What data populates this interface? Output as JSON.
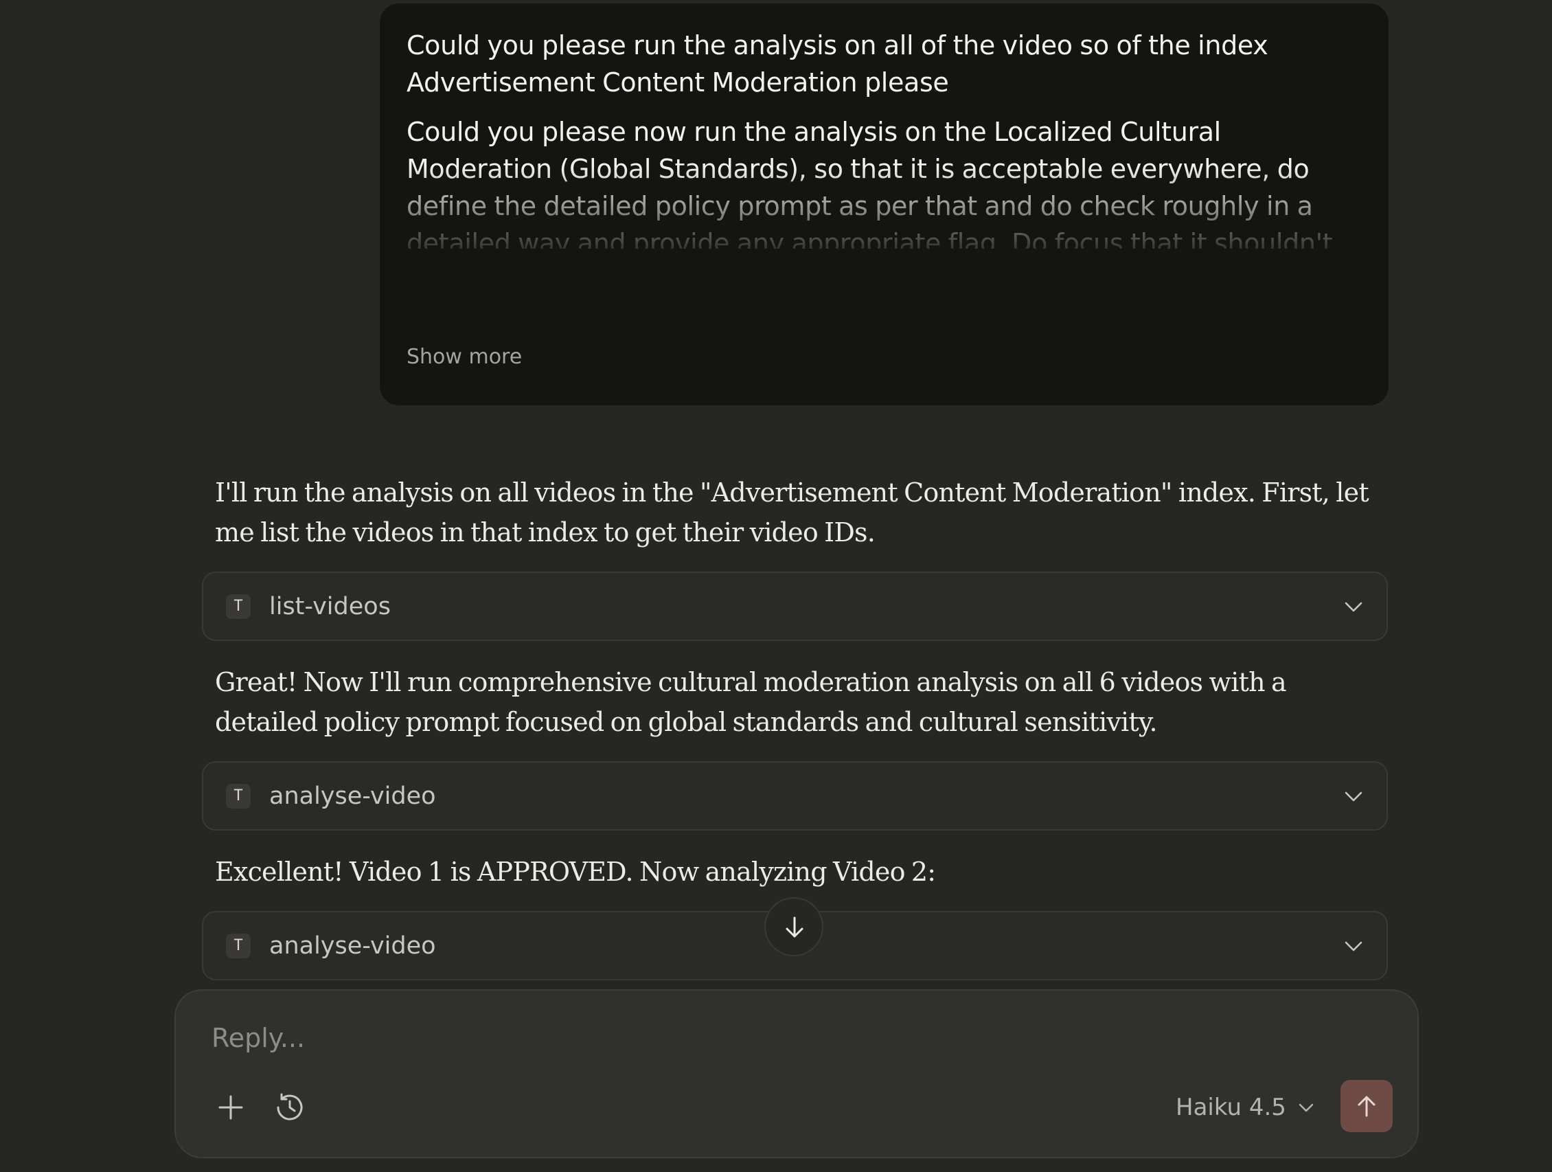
{
  "user_message": {
    "paragraph_1": "Could you please run the analysis on all of the video so of the index Advertisement Content Moderation please",
    "paragraph_2": "Could you please now run the analysis on the Localized Cultural Moderation (Global Standards), so that it is acceptable everywhere, do define the detailed policy prompt as per that and do check roughly in a detailed way and provide any appropriate flag. Do focus that it shouldn't harm any cultural belief and norms please, There are some ads which are for specific region, so do understand that",
    "show_more_label": "Show more"
  },
  "assistant": {
    "message_1": "I'll run the analysis on all videos in the \"Advertisement Content Moderation\" index. First, let me list the videos in that index to get their video IDs.",
    "tool_1": {
      "icon_letter": "T",
      "name": "list-videos"
    },
    "message_2": "Great! Now I'll run comprehensive cultural moderation analysis on all 6 videos with a detailed policy prompt focused on global standards and cultural sensitivity.",
    "tool_2": {
      "icon_letter": "T",
      "name": "analyse-video"
    },
    "message_3": "Excellent! Video 1 is APPROVED. Now analyzing Video 2:",
    "tool_3": {
      "icon_letter": "T",
      "name": "analyse-video"
    }
  },
  "composer": {
    "placeholder": "Reply...",
    "model_label": "Haiku 4.5"
  },
  "icons": {
    "tool": "text-tool-icon",
    "expand": "chevron-down-icon",
    "scroll": "arrow-down-icon",
    "add": "plus-icon",
    "history": "clock-history-icon",
    "send": "arrow-up-icon"
  },
  "colors": {
    "background": "#262624",
    "user_bubble": "#141413",
    "composer": "#30302E",
    "send_button": "#6E4B45"
  }
}
